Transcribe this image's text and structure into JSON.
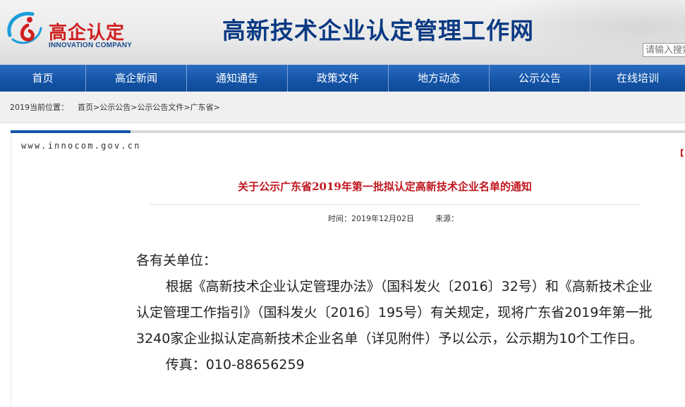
{
  "header": {
    "logo_cn": "高企认定",
    "logo_en": "INNOVATION COMPANY",
    "site_title": "高新技术企业认定管理工作网",
    "search_placeholder": "请输入搜索"
  },
  "nav": {
    "items": [
      "首页",
      "高企新闻",
      "通知通告",
      "政策文件",
      "地方动态",
      "公示公告",
      "在线培训"
    ]
  },
  "breadcrumb": {
    "year": "2019",
    "label": "当前位置：",
    "path": [
      "首页",
      "公示公告",
      "公示公告文件",
      "广东省"
    ],
    "separator": ">"
  },
  "content": {
    "site_url": "www.innocom.gov.cn",
    "right_tag": "【",
    "title": "关于公示广东省2019年第一批拟认定高新技术企业名单的通知",
    "time_label": "时间：",
    "time_value": "2019年12月02日",
    "source_label": "来源：",
    "source_value": "",
    "salutation": "各有关单位：",
    "paragraph1": "根据《高新技术企业认定管理办法》（国科发火〔2016〕32号）和《高新技术企业认定管理工作指引》（国科发火〔2016〕195号）有关规定，现将广东省2019年第一批3240家企业拟认定高新技术企业名单（详见附件）予以公示，公示期为10个工作日。",
    "fax": "传真：010-88656259"
  },
  "colors": {
    "nav_bg": "#1455a8",
    "title_red": "#c0171e",
    "site_title_blue": "#0b3a83",
    "logo_red": "#d02020"
  }
}
